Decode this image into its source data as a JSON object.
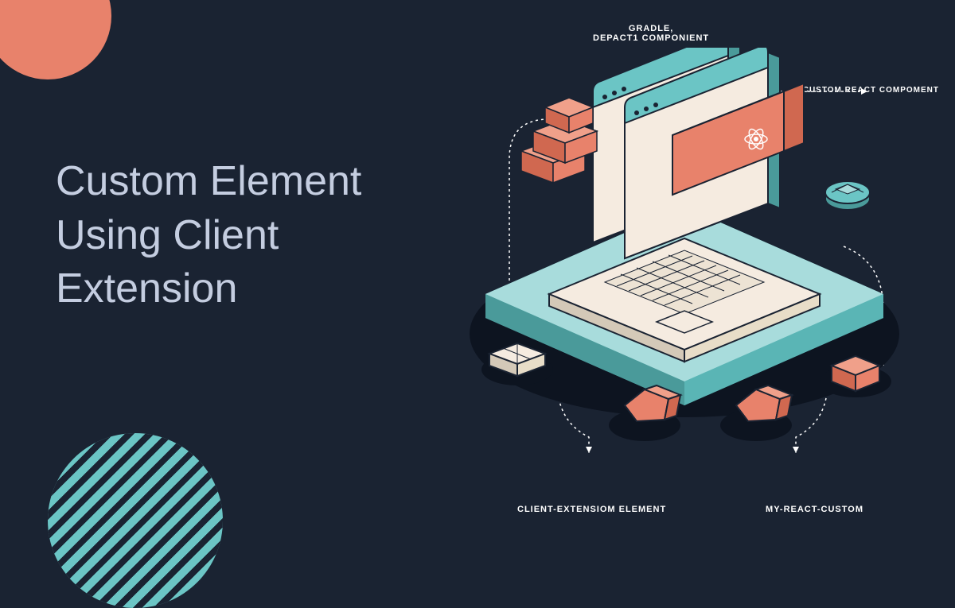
{
  "title": "Custom Element Using Client Extension",
  "labels": {
    "top": "GRADLE,\nDEPACT1 COMPONIENT",
    "right": "CUSTOM REACT COMPOMENT",
    "bottomLeft": "CLIENT-EXTENSIOM ELEMENT",
    "bottomRight": "MY-REACT-CUSTOM"
  },
  "colors": {
    "background": "#1a2332",
    "coral": "#e8826b",
    "teal": "#6bc5c5",
    "cream": "#f5ebe0",
    "darkTeal": "#3a8b8b",
    "textLight": "#c4cde0"
  }
}
